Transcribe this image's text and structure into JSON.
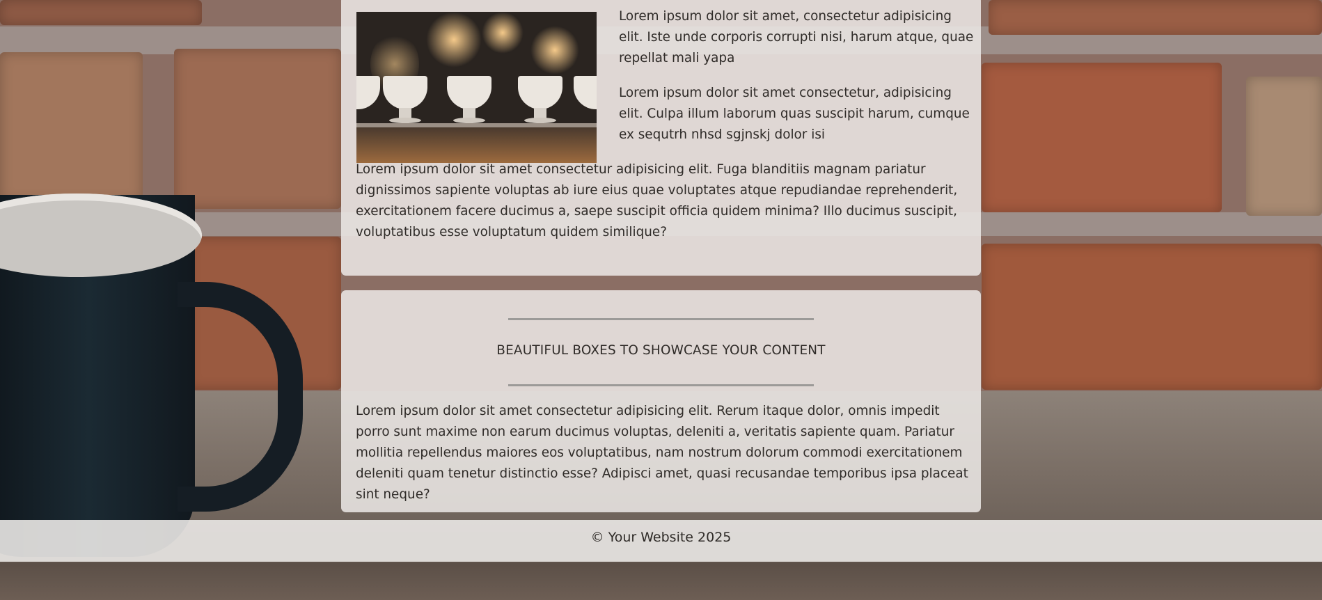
{
  "article": {
    "image_alt": "pour-over coffee drippers on a counter",
    "para_a": "Lorem ipsum dolor sit amet, consectetur adipisicing elit. Iste unde corporis corrupti nisi, harum atque, quae repellat mali yapa",
    "para_b": "Lorem ipsum dolor sit amet consectetur, adipisicing elit. Culpa illum laborum quas suscipit harum, cumque ex sequtrh nhsd sgjnskj dolor isi",
    "para_c": "Lorem ipsum dolor sit amet consectetur adipisicing elit. Fuga blanditiis magnam pariatur dignissimos sapiente voluptas ab iure eius quae voluptates atque repudiandae reprehenderit, exercitationem facere ducimus a, saepe suscipit officia quidem minima? Illo ducimus suscipit, voluptatibus esse voluptatum quidem similique?"
  },
  "showcase": {
    "title": "BEAUTIFUL BOXES TO SHOWCASE YOUR CONTENT",
    "body": "Lorem ipsum dolor sit amet consectetur adipisicing elit. Rerum itaque dolor, omnis impedit porro sunt maxime non earum ducimus voluptas, deleniti a, veritatis sapiente quam. Pariatur mollitia repellendus maiores eos voluptatibus, nam nostrum dolorum commodi exercitationem deleniti quam tenetur distinctio esse? Adipisci amet, quasi recusandae temporibus ipsa placeat sint neque?"
  },
  "footer": {
    "copyright": "© Your Website 2025"
  },
  "colors": {
    "box_background": "#ece9e7",
    "text": "#2f2b28",
    "rule": "#9c9a98"
  }
}
